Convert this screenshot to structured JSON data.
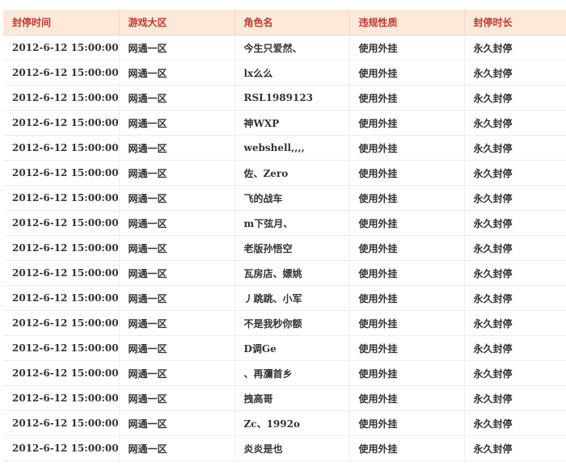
{
  "table": {
    "headers": [
      "封停时间",
      "游戏大区",
      "角色名",
      "违规性质",
      "封停时长"
    ],
    "rows": [
      [
        "2012-6-12 15:00:00",
        "网通一区",
        "今生只爱然、",
        "使用外挂",
        "永久封停"
      ],
      [
        "2012-6-12 15:00:00",
        "网通一区",
        "lx么么",
        "使用外挂",
        "永久封停"
      ],
      [
        "2012-6-12 15:00:00",
        "网通一区",
        "RSL1989123",
        "使用外挂",
        "永久封停"
      ],
      [
        "2012-6-12 15:00:00",
        "网通一区",
        "神WXP",
        "使用外挂",
        "永久封停"
      ],
      [
        "2012-6-12 15:00:00",
        "网通一区",
        "webshell,,,,",
        "使用外挂",
        "永久封停"
      ],
      [
        "2012-6-12 15:00:00",
        "网通一区",
        "佐、Zero",
        "使用外挂",
        "永久封停"
      ],
      [
        "2012-6-12 15:00:00",
        "网通一区",
        "飞的战车",
        "使用外挂",
        "永久封停"
      ],
      [
        "2012-6-12 15:00:00",
        "网通一区",
        "m下弦月、",
        "使用外挂",
        "永久封停"
      ],
      [
        "2012-6-12 15:00:00",
        "网通一区",
        "老版孙悟空",
        "使用外挂",
        "永久封停"
      ],
      [
        "2012-6-12 15:00:00",
        "网通一区",
        "瓦房店、嫖姚",
        "使用外挂",
        "永久封停"
      ],
      [
        "2012-6-12 15:00:00",
        "网通一区",
        "丿跳跳、小军",
        "使用外挂",
        "永久封停"
      ],
      [
        "2012-6-12 15:00:00",
        "网通一区",
        "不是我秒你额",
        "使用外挂",
        "永久封停"
      ],
      [
        "2012-6-12 15:00:00",
        "网通一区",
        "D调Ge",
        "使用外挂",
        "永久封停"
      ],
      [
        "2012-6-12 15:00:00",
        "网通一区",
        "、再瀰首乡",
        "使用外挂",
        "永久封停"
      ],
      [
        "2012-6-12 15:00:00",
        "网通一区",
        "拽高哥",
        "使用外挂",
        "永久封停"
      ],
      [
        "2012-6-12 15:00:00",
        "网通一区",
        "Zc、1992o",
        "使用外挂",
        "永久封停"
      ],
      [
        "2012-6-12 15:00:00",
        "网通一区",
        "炎炎是也",
        "使用外挂",
        "永久封停"
      ]
    ]
  },
  "colors": {
    "header_background": "#fde9da",
    "header_text": "#c0392b",
    "cell_text": "#333333",
    "row_divider": "#ececec"
  }
}
